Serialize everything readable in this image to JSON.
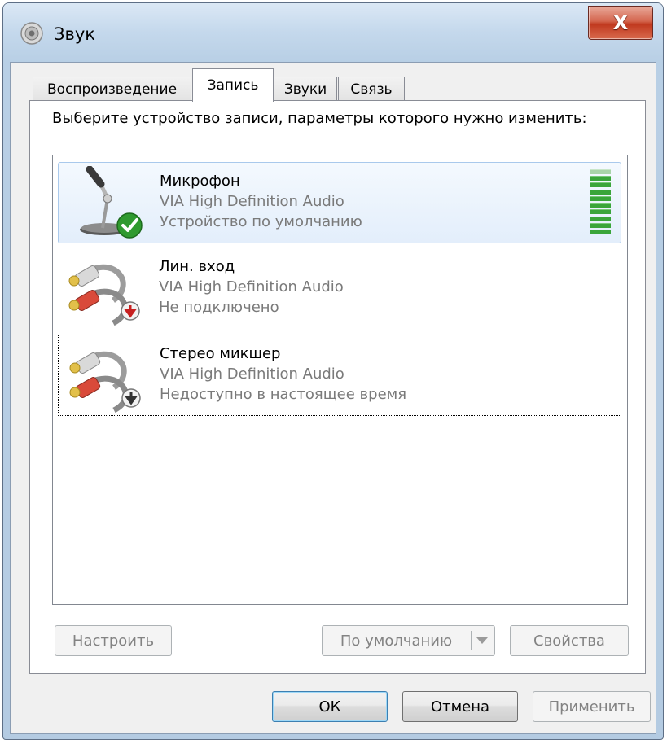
{
  "window": {
    "title": "Звук",
    "close_glyph": "X",
    "icon": "speaker-icon"
  },
  "tabs": [
    {
      "label": "Воспроизведение",
      "active": false
    },
    {
      "label": "Запись",
      "active": true
    },
    {
      "label": "Звуки",
      "active": false
    },
    {
      "label": "Связь",
      "active": false
    }
  ],
  "instruction": "Выберите устройство записи, параметры которого нужно изменить:",
  "devices": [
    {
      "name": "Микрофон",
      "driver": "VIA High Definition Audio",
      "status": "Устройство по умолчанию",
      "icon": "microphone-icon",
      "badge": "default-check-icon",
      "selected": true,
      "level_active_bars": 9,
      "level_total_bars": 10
    },
    {
      "name": "Лин. вход",
      "driver": "VIA High Definition Audio",
      "status": "Не подключено",
      "icon": "rca-cable-icon",
      "badge": "red-down-arrow-icon"
    },
    {
      "name": "Стерео микшер",
      "driver": "VIA High Definition Audio",
      "status": "Недоступно в настоящее время",
      "icon": "rca-cable-icon",
      "badge": "gray-down-arrow-icon",
      "focused": true
    }
  ],
  "buttons": {
    "configure": {
      "label": "Настроить",
      "disabled": true
    },
    "set_default": {
      "label": "По умолчанию",
      "disabled": true
    },
    "properties": {
      "label": "Свойства",
      "disabled": true
    },
    "ok": {
      "label": "ОК"
    },
    "cancel": {
      "label": "Отмена"
    },
    "apply": {
      "label": "Применить",
      "disabled": true
    }
  },
  "colors": {
    "level_green": "#3aa53a",
    "selection_bg": "#e3eefb",
    "close_red": "#c0391f"
  }
}
